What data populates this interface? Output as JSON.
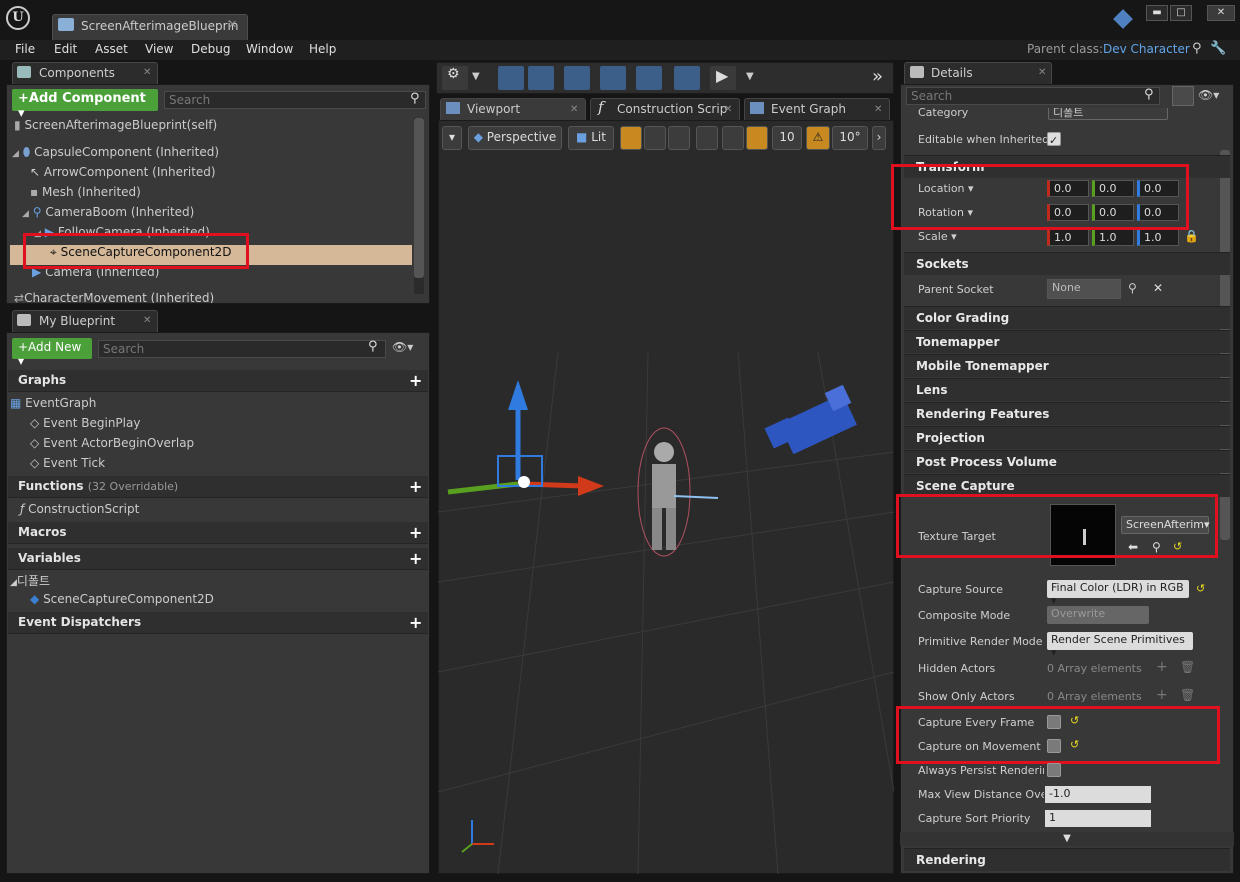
{
  "window": {
    "tab_title": "ScreenAfterimageBlueprin",
    "btn_min": "▬",
    "btn_max": "□",
    "btn_close": "✕"
  },
  "menu": [
    "File",
    "Edit",
    "Asset",
    "View",
    "Debug",
    "Window",
    "Help"
  ],
  "parent_class": {
    "label": "Parent class:",
    "value": "Dev Character"
  },
  "components": {
    "tab": "Components",
    "add_button": "+Add Component ▾",
    "search_placeholder": "Search",
    "items": [
      "ScreenAfterimageBlueprint(self)",
      "CapsuleComponent (Inherited)",
      "ArrowComponent (Inherited)",
      "Mesh (Inherited)",
      "CameraBoom (Inherited)",
      "FollowCamera (Inherited)",
      "SceneCaptureComponent2D",
      "Camera (Inherited)",
      "CharacterMovement (Inherited)"
    ]
  },
  "my_blueprint": {
    "tab": "My Blueprint",
    "add_button": "+Add New ▾",
    "search_placeholder": "Search",
    "graphs": "Graphs",
    "event_graph": "EventGraph",
    "events": [
      "Event BeginPlay",
      "Event ActorBeginOverlap",
      "Event Tick"
    ],
    "functions": "Functions",
    "functions_count": "(32 Overridable)",
    "construction_script": "ConstructionScript",
    "macros": "Macros",
    "variables": "Variables",
    "var_category": "디폴트",
    "var_item": "SceneCaptureComponent2D",
    "dispatchers": "Event Dispatchers"
  },
  "viewport": {
    "tabs": [
      "Viewport",
      "Construction Scrip",
      "Event Graph"
    ],
    "perspective": "Perspective",
    "lit": "Lit",
    "grid_snap": "10",
    "rot_snap": "10°"
  },
  "details": {
    "tab": "Details",
    "search_placeholder": "Search",
    "category_label": "Category",
    "category_value": "디폴트",
    "editable_label": "Editable when Inherited",
    "transform": "Transform",
    "location_label": "Location ▾",
    "location": [
      "0.0",
      "0.0",
      "0.0"
    ],
    "rotation_label": "Rotation ▾",
    "rotation": [
      "0.0",
      "0.0",
      "0.0"
    ],
    "scale_label": "Scale ▾",
    "scale": [
      "1.0",
      "1.0",
      "1.0"
    ],
    "sockets": "Sockets",
    "parent_socket_label": "Parent Socket",
    "parent_socket_value": "None",
    "sections": [
      "Color Grading",
      "Tonemapper",
      "Mobile Tonemapper",
      "Lens",
      "Rendering Features",
      "Projection",
      "Post Process Volume"
    ],
    "scene_capture": "Scene Capture",
    "texture_target_label": "Texture Target",
    "texture_target_value": "ScreenAfterim▾",
    "capture_source_label": "Capture Source",
    "capture_source_value": "Final Color (LDR) in RGB ▾",
    "composite_label": "Composite Mode",
    "composite_value": "Overwrite",
    "primitive_label": "Primitive Render Mode",
    "primitive_value": "Render Scene Primitives ▾",
    "hidden_label": "Hidden Actors",
    "hidden_value": "0 Array elements",
    "showonly_label": "Show Only Actors",
    "showonly_value": "0 Array elements",
    "every_frame_label": "Capture Every Frame",
    "on_movement_label": "Capture on Movement",
    "persist_label": "Always Persist Renderin",
    "max_view_label": "Max View Distance Over",
    "max_view_value": "-1.0",
    "sort_label": "Capture Sort Priority",
    "sort_value": "1",
    "rendering": "Rendering"
  },
  "colors": {
    "accent_blue": "#61a5e8",
    "highlight": "#d4b898",
    "red_box": "#e0101e",
    "add_green": "#4ba03a"
  }
}
